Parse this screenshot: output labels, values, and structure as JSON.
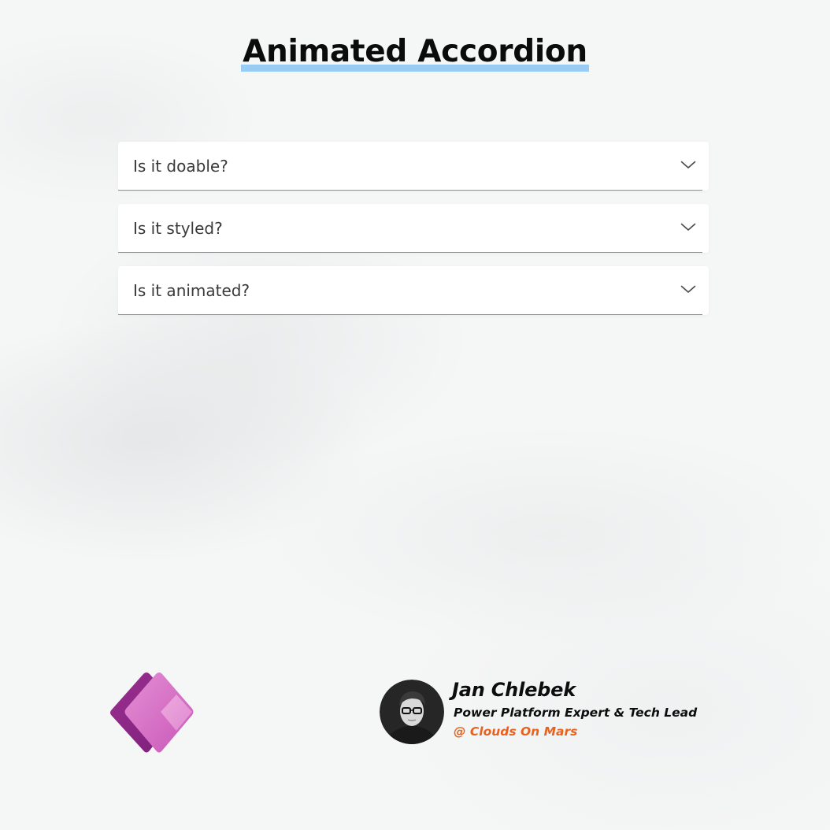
{
  "header": {
    "title": "Animated Accordion",
    "underline_color": "#99ccf5"
  },
  "accordion": {
    "items": [
      {
        "label": "Is it doable?",
        "expanded": false,
        "icon": "chevron-down-icon"
      },
      {
        "label": "Is it styled?",
        "expanded": false,
        "icon": "chevron-down-icon"
      },
      {
        "label": "Is it animated?",
        "expanded": false,
        "icon": "chevron-down-icon"
      }
    ]
  },
  "footer": {
    "logo_icon": "power-apps-logo-icon",
    "author": {
      "name": "Jan Chlebek",
      "role": "Power Platform Expert & Tech Lead",
      "company": "@ Clouds On Mars",
      "company_color": "#e8621f"
    }
  }
}
